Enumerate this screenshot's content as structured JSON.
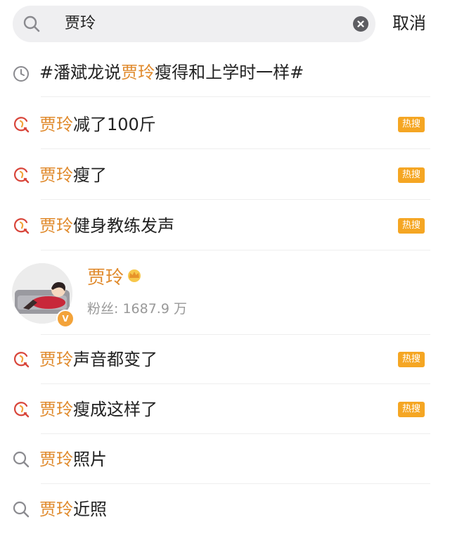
{
  "search": {
    "query": "贾玲",
    "cancel_label": "取消"
  },
  "highlight_color": "#e08a2c",
  "badge_color": "#f5a623",
  "history": {
    "icon": "clock-icon",
    "prefix": "#潘斌龙说",
    "highlight": "贾玲",
    "suffix": "瘦得和上学时一样#"
  },
  "suggestions_top": [
    {
      "icon": "hot-search-icon",
      "highlight": "贾玲",
      "rest": "减了100斤",
      "badge": "热搜"
    },
    {
      "icon": "hot-search-icon",
      "highlight": "贾玲",
      "rest": "瘦了",
      "badge": "热搜"
    },
    {
      "icon": "hot-search-icon",
      "highlight": "贾玲",
      "rest": "健身教练发声",
      "badge": "热搜"
    }
  ],
  "user": {
    "name": "贾玲",
    "fans_label": "粉丝: 1687.9 万",
    "verified_icon": "v-badge-icon",
    "crown_icon": "crown-icon"
  },
  "suggestions_bottom": [
    {
      "icon": "hot-search-icon",
      "highlight": "贾玲",
      "rest": "声音都变了",
      "badge": "热搜"
    },
    {
      "icon": "hot-search-icon",
      "highlight": "贾玲",
      "rest": "瘦成这样了",
      "badge": "热搜"
    },
    {
      "icon": "search-icon",
      "highlight": "贾玲",
      "rest": "照片",
      "badge": ""
    },
    {
      "icon": "search-icon",
      "highlight": "贾玲",
      "rest": "近照",
      "badge": ""
    }
  ]
}
